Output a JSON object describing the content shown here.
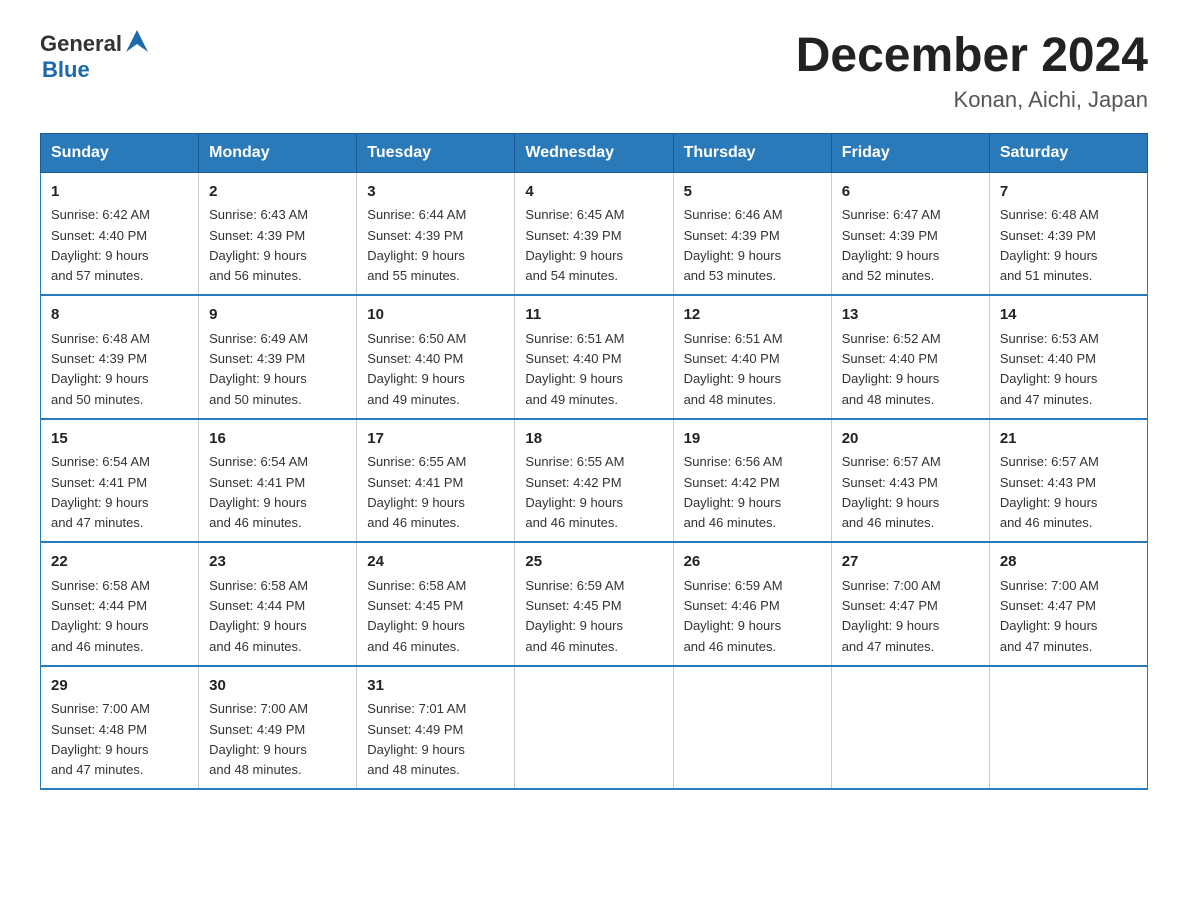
{
  "header": {
    "logo_general": "General",
    "logo_blue": "Blue",
    "title": "December 2024",
    "subtitle": "Konan, Aichi, Japan"
  },
  "days_of_week": [
    "Sunday",
    "Monday",
    "Tuesday",
    "Wednesday",
    "Thursday",
    "Friday",
    "Saturday"
  ],
  "weeks": [
    [
      {
        "day": "1",
        "sunrise": "6:42 AM",
        "sunset": "4:40 PM",
        "daylight": "9 hours and 57 minutes."
      },
      {
        "day": "2",
        "sunrise": "6:43 AM",
        "sunset": "4:39 PM",
        "daylight": "9 hours and 56 minutes."
      },
      {
        "day": "3",
        "sunrise": "6:44 AM",
        "sunset": "4:39 PM",
        "daylight": "9 hours and 55 minutes."
      },
      {
        "day": "4",
        "sunrise": "6:45 AM",
        "sunset": "4:39 PM",
        "daylight": "9 hours and 54 minutes."
      },
      {
        "day": "5",
        "sunrise": "6:46 AM",
        "sunset": "4:39 PM",
        "daylight": "9 hours and 53 minutes."
      },
      {
        "day": "6",
        "sunrise": "6:47 AM",
        "sunset": "4:39 PM",
        "daylight": "9 hours and 52 minutes."
      },
      {
        "day": "7",
        "sunrise": "6:48 AM",
        "sunset": "4:39 PM",
        "daylight": "9 hours and 51 minutes."
      }
    ],
    [
      {
        "day": "8",
        "sunrise": "6:48 AM",
        "sunset": "4:39 PM",
        "daylight": "9 hours and 50 minutes."
      },
      {
        "day": "9",
        "sunrise": "6:49 AM",
        "sunset": "4:39 PM",
        "daylight": "9 hours and 50 minutes."
      },
      {
        "day": "10",
        "sunrise": "6:50 AM",
        "sunset": "4:40 PM",
        "daylight": "9 hours and 49 minutes."
      },
      {
        "day": "11",
        "sunrise": "6:51 AM",
        "sunset": "4:40 PM",
        "daylight": "9 hours and 49 minutes."
      },
      {
        "day": "12",
        "sunrise": "6:51 AM",
        "sunset": "4:40 PM",
        "daylight": "9 hours and 48 minutes."
      },
      {
        "day": "13",
        "sunrise": "6:52 AM",
        "sunset": "4:40 PM",
        "daylight": "9 hours and 48 minutes."
      },
      {
        "day": "14",
        "sunrise": "6:53 AM",
        "sunset": "4:40 PM",
        "daylight": "9 hours and 47 minutes."
      }
    ],
    [
      {
        "day": "15",
        "sunrise": "6:54 AM",
        "sunset": "4:41 PM",
        "daylight": "9 hours and 47 minutes."
      },
      {
        "day": "16",
        "sunrise": "6:54 AM",
        "sunset": "4:41 PM",
        "daylight": "9 hours and 46 minutes."
      },
      {
        "day": "17",
        "sunrise": "6:55 AM",
        "sunset": "4:41 PM",
        "daylight": "9 hours and 46 minutes."
      },
      {
        "day": "18",
        "sunrise": "6:55 AM",
        "sunset": "4:42 PM",
        "daylight": "9 hours and 46 minutes."
      },
      {
        "day": "19",
        "sunrise": "6:56 AM",
        "sunset": "4:42 PM",
        "daylight": "9 hours and 46 minutes."
      },
      {
        "day": "20",
        "sunrise": "6:57 AM",
        "sunset": "4:43 PM",
        "daylight": "9 hours and 46 minutes."
      },
      {
        "day": "21",
        "sunrise": "6:57 AM",
        "sunset": "4:43 PM",
        "daylight": "9 hours and 46 minutes."
      }
    ],
    [
      {
        "day": "22",
        "sunrise": "6:58 AM",
        "sunset": "4:44 PM",
        "daylight": "9 hours and 46 minutes."
      },
      {
        "day": "23",
        "sunrise": "6:58 AM",
        "sunset": "4:44 PM",
        "daylight": "9 hours and 46 minutes."
      },
      {
        "day": "24",
        "sunrise": "6:58 AM",
        "sunset": "4:45 PM",
        "daylight": "9 hours and 46 minutes."
      },
      {
        "day": "25",
        "sunrise": "6:59 AM",
        "sunset": "4:45 PM",
        "daylight": "9 hours and 46 minutes."
      },
      {
        "day": "26",
        "sunrise": "6:59 AM",
        "sunset": "4:46 PM",
        "daylight": "9 hours and 46 minutes."
      },
      {
        "day": "27",
        "sunrise": "7:00 AM",
        "sunset": "4:47 PM",
        "daylight": "9 hours and 47 minutes."
      },
      {
        "day": "28",
        "sunrise": "7:00 AM",
        "sunset": "4:47 PM",
        "daylight": "9 hours and 47 minutes."
      }
    ],
    [
      {
        "day": "29",
        "sunrise": "7:00 AM",
        "sunset": "4:48 PM",
        "daylight": "9 hours and 47 minutes."
      },
      {
        "day": "30",
        "sunrise": "7:00 AM",
        "sunset": "4:49 PM",
        "daylight": "9 hours and 48 minutes."
      },
      {
        "day": "31",
        "sunrise": "7:01 AM",
        "sunset": "4:49 PM",
        "daylight": "9 hours and 48 minutes."
      },
      null,
      null,
      null,
      null
    ]
  ],
  "labels": {
    "sunrise": "Sunrise:",
    "sunset": "Sunset:",
    "daylight": "Daylight:"
  }
}
